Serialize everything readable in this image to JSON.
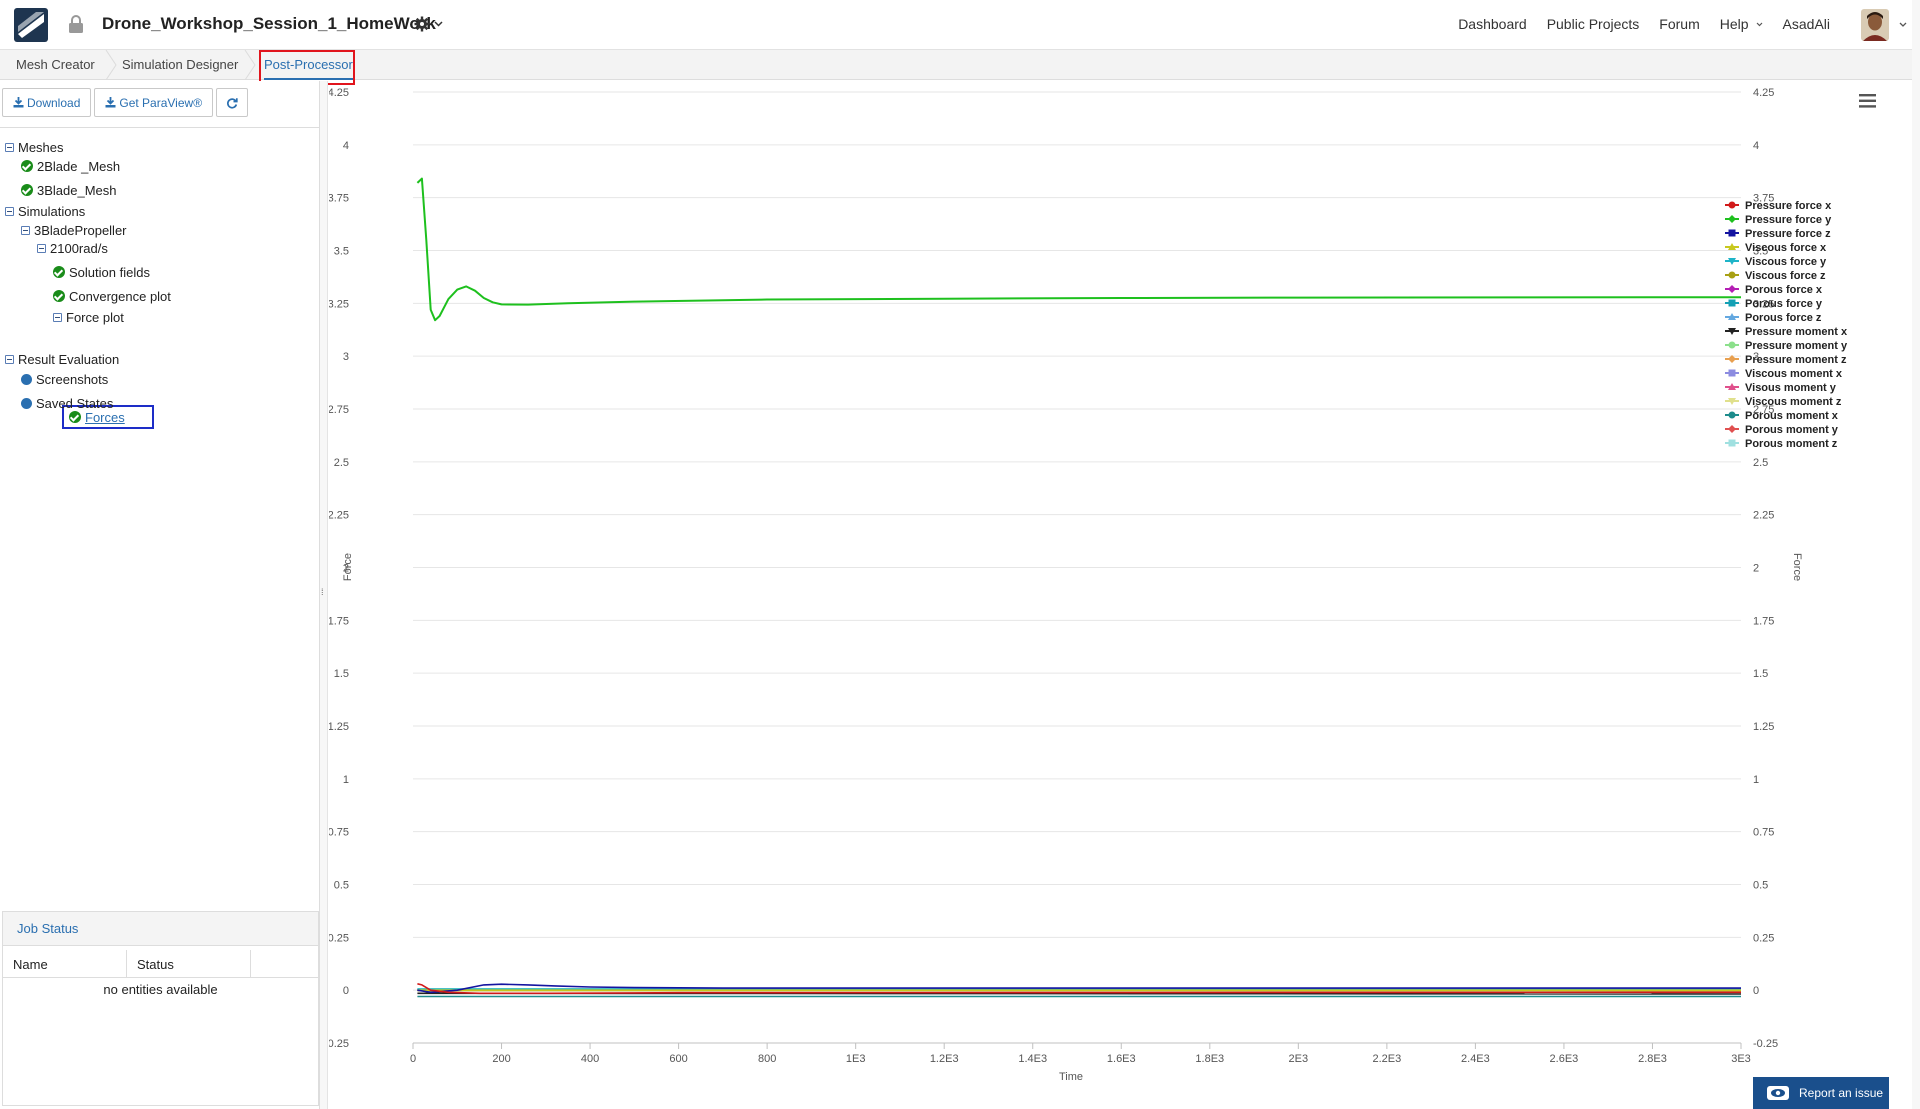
{
  "header": {
    "project_title": "Drone_Workshop_Session_1_HomeWork",
    "nav": [
      "Dashboard",
      "Public Projects",
      "Forum",
      "Help",
      "AsadAli"
    ],
    "icons": [
      "logo-icon",
      "lock-icon",
      "gear-icon",
      "chevron-down-icon",
      "avatar"
    ]
  },
  "tabs": [
    "Mesh Creator",
    "Simulation Designer",
    "Post-Processor"
  ],
  "active_tab": "Post-Processor",
  "toolbar": {
    "download": "Download",
    "paraview": "Get ParaView®",
    "refresh_icon": "refresh-icon"
  },
  "tree": {
    "meshes": {
      "label": "Meshes",
      "items": [
        "2Blade _Mesh",
        "3Blade_Mesh"
      ]
    },
    "simulations": {
      "label": "Simulations"
    },
    "sim_name": "3BladePropeller",
    "run_name": "2100rad/s",
    "solution_fields": "Solution fields",
    "convergence_plot": "Convergence plot",
    "force_plot": "Force plot",
    "forces": "Forces",
    "result_eval": {
      "label": "Result Evaluation",
      "items": [
        "Screenshots",
        "Saved States"
      ]
    }
  },
  "job_status": {
    "title": "Job Status",
    "columns": [
      "Name",
      "Status"
    ],
    "empty": "no entities available"
  },
  "report_button": "Report an issue",
  "colors": {
    "accent": "#2a6fb0",
    "highlight_red": "#e1141c",
    "highlight_blue": "#1d2dc7",
    "success": "#1a8c1a",
    "report_bg": "#1a4f8c"
  },
  "chart_data": {
    "type": "line",
    "title": "",
    "xlabel": "Time",
    "ylabel": "Force",
    "ylabel_right": "Force",
    "xlim": [
      0,
      3000
    ],
    "ylim": [
      -0.25,
      4.25
    ],
    "xticks": [
      0,
      200,
      400,
      600,
      800,
      1000,
      1200,
      1400,
      1600,
      1800,
      2000,
      2200,
      2400,
      2600,
      2800,
      3000
    ],
    "xtick_labels": [
      "0",
      "200",
      "400",
      "600",
      "800",
      "1E3",
      "1.2E3",
      "1.4E3",
      "1.6E3",
      "1.8E3",
      "2E3",
      "2.2E3",
      "2.4E3",
      "2.6E3",
      "2.8E3",
      "3E3"
    ],
    "yticks": [
      -0.25,
      0,
      0.25,
      0.5,
      0.75,
      1,
      1.25,
      1.5,
      1.75,
      2,
      2.25,
      2.5,
      2.75,
      3,
      3.25,
      3.5,
      3.75,
      4,
      4.25
    ],
    "ytick_labels": [
      "-0.25",
      "0",
      "0.25",
      "0.5",
      "0.75",
      "1",
      "1.25",
      "1.5",
      "1.75",
      "2",
      "2.25",
      "2.5",
      "2.75",
      "3",
      "3.25",
      "3.5",
      "3.75",
      "4",
      "4.25"
    ],
    "grid": true,
    "legend_position": "right",
    "series": [
      {
        "name": "Pressure force x",
        "color": "#d11a1a",
        "marker": "circle",
        "x": [
          10,
          20,
          40,
          80,
          150,
          300,
          600,
          3000
        ],
        "y": [
          0.03,
          0.025,
          0.0,
          -0.01,
          -0.015,
          -0.015,
          -0.012,
          -0.01
        ]
      },
      {
        "name": "Pressure force y",
        "color": "#1ec01e",
        "marker": "diamond",
        "x": [
          10,
          20,
          30,
          40,
          50,
          60,
          80,
          100,
          120,
          140,
          160,
          180,
          200,
          260,
          350,
          500,
          800,
          1200,
          1600,
          2000,
          2500,
          3000
        ],
        "y": [
          3.82,
          3.84,
          3.55,
          3.22,
          3.17,
          3.19,
          3.27,
          3.315,
          3.33,
          3.31,
          3.275,
          3.255,
          3.245,
          3.244,
          3.25,
          3.258,
          3.268,
          3.272,
          3.275,
          3.277,
          3.278,
          3.279
        ]
      },
      {
        "name": "Pressure force z",
        "color": "#1414a0",
        "marker": "square",
        "x": [
          10,
          40,
          100,
          160,
          200,
          260,
          320,
          400,
          500,
          700,
          3000
        ],
        "y": [
          0.0,
          -0.01,
          0.0,
          0.025,
          0.028,
          0.025,
          0.02,
          0.015,
          0.012,
          0.01,
          0.01
        ]
      },
      {
        "name": "Viscous force x",
        "color": "#c8c81e",
        "marker": "triangle",
        "x": [
          10,
          3000
        ],
        "y": [
          0.0,
          0.0
        ]
      },
      {
        "name": "Viscous force y",
        "color": "#1eb4c8",
        "marker": "triangle-down",
        "x": [
          10,
          3000
        ],
        "y": [
          0.005,
          0.005
        ]
      },
      {
        "name": "Viscous force z",
        "color": "#a8a014",
        "marker": "circle",
        "x": [
          10,
          3000
        ],
        "y": [
          -0.002,
          -0.002
        ]
      },
      {
        "name": "Porous force x",
        "color": "#b41eb4",
        "marker": "diamond",
        "x": [
          10,
          3000
        ],
        "y": [
          0.0,
          0.0
        ]
      },
      {
        "name": "Porous force y",
        "color": "#14a0b4",
        "marker": "square",
        "x": [
          10,
          3000
        ],
        "y": [
          0.0,
          0.0
        ]
      },
      {
        "name": "Porous force z",
        "color": "#64a8e0",
        "marker": "triangle",
        "x": [
          10,
          3000
        ],
        "y": [
          0.0,
          0.0
        ]
      },
      {
        "name": "Pressure moment x",
        "color": "#222222",
        "marker": "triangle-down",
        "x": [
          10,
          3000
        ],
        "y": [
          -0.015,
          -0.018
        ]
      },
      {
        "name": "Pressure moment y",
        "color": "#8ce08c",
        "marker": "circle",
        "x": [
          10,
          3000
        ],
        "y": [
          0.005,
          0.005
        ]
      },
      {
        "name": "Pressure moment z",
        "color": "#e8a050",
        "marker": "diamond",
        "x": [
          10,
          3000
        ],
        "y": [
          0.0,
          0.0
        ]
      },
      {
        "name": "Viscous moment x",
        "color": "#8c8ce0",
        "marker": "square",
        "x": [
          10,
          3000
        ],
        "y": [
          0.0,
          0.0
        ]
      },
      {
        "name": "Visous moment y",
        "color": "#e0508c",
        "marker": "triangle",
        "x": [
          10,
          3000
        ],
        "y": [
          0.0,
          0.0
        ]
      },
      {
        "name": "Viscous moment z",
        "color": "#e0e08c",
        "marker": "triangle-down",
        "x": [
          10,
          3000
        ],
        "y": [
          0.0,
          0.0
        ]
      },
      {
        "name": "Porous moment x",
        "color": "#1e8c8c",
        "marker": "circle",
        "x": [
          10,
          3000
        ],
        "y": [
          -0.03,
          -0.03
        ]
      },
      {
        "name": "Porous moment y",
        "color": "#e05050",
        "marker": "diamond",
        "x": [
          10,
          3000
        ],
        "y": [
          0.0,
          0.0
        ]
      },
      {
        "name": "Porous moment z",
        "color": "#a0e0e0",
        "marker": "square",
        "x": [
          10,
          3000
        ],
        "y": [
          0.0,
          0.0
        ]
      }
    ]
  }
}
